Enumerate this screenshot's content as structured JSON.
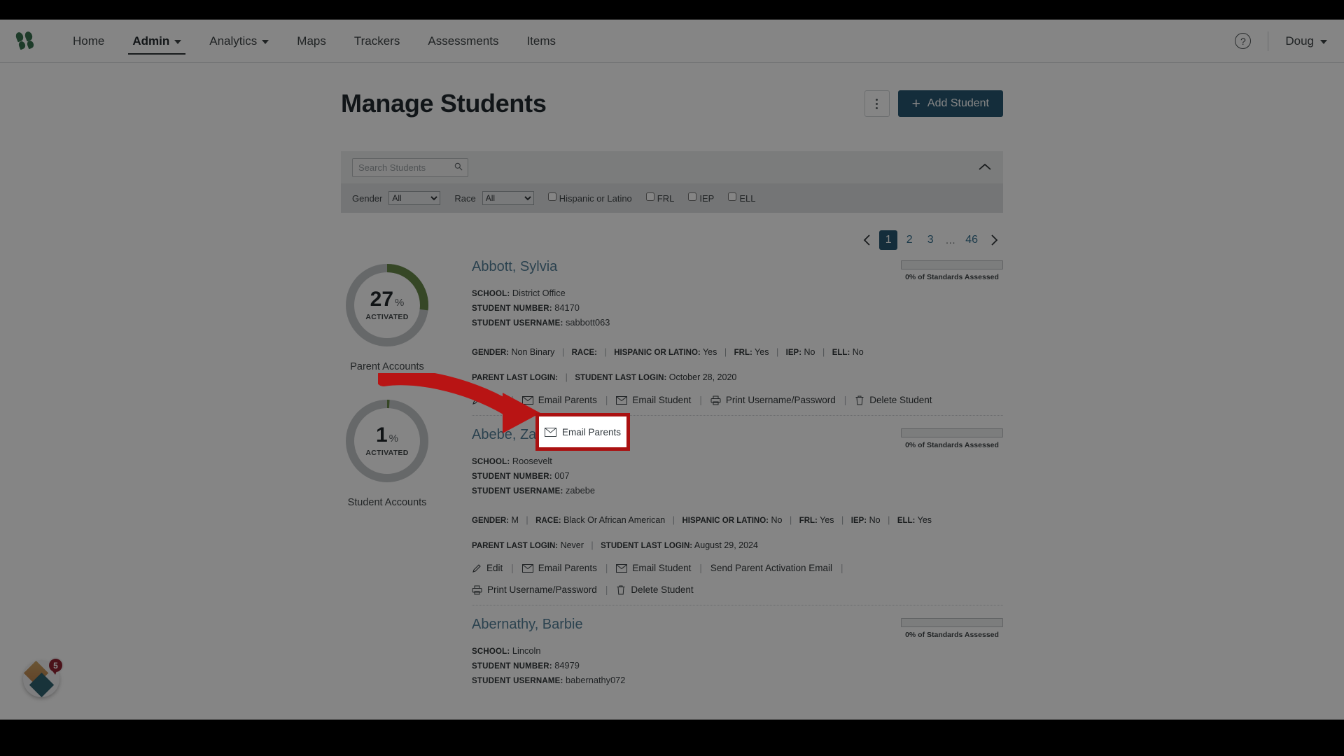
{
  "nav": {
    "logo_name": "logo-icon",
    "items": [
      {
        "label": "Home",
        "has_caret": false,
        "active": false
      },
      {
        "label": "Admin",
        "has_caret": true,
        "active": true
      },
      {
        "label": "Analytics",
        "has_caret": true,
        "active": false
      },
      {
        "label": "Maps",
        "has_caret": false,
        "active": false
      },
      {
        "label": "Trackers",
        "has_caret": false,
        "active": false
      },
      {
        "label": "Assessments",
        "has_caret": false,
        "active": false
      },
      {
        "label": "Items",
        "has_caret": false,
        "active": false
      }
    ],
    "help_glyph": "?",
    "user": "Doug"
  },
  "header": {
    "title": "Manage Students",
    "kebab_name": "more-options",
    "add_student_label": "Add Student",
    "add_student_plus": "+",
    "accent_color": "#0f5c87"
  },
  "filters": {
    "search_placeholder": "Search Students",
    "search_value": "",
    "collapse_name": "chevron-up-icon",
    "gender_label": "Gender",
    "gender_value": "All",
    "gender_options": [
      "All"
    ],
    "race_label": "Race",
    "race_value": "All",
    "race_options": [
      "All"
    ],
    "checkboxes": [
      {
        "label": "Hispanic or Latino",
        "checked": false
      },
      {
        "label": "FRL",
        "checked": false
      },
      {
        "label": "IEP",
        "checked": false
      },
      {
        "label": "ELL",
        "checked": false
      }
    ]
  },
  "pagination": {
    "prev_glyph": "‹",
    "next_glyph": "›",
    "pages": [
      "1",
      "2",
      "3"
    ],
    "ellipsis": "…",
    "last_page": "46",
    "current": "1"
  },
  "donuts": [
    {
      "value": "27",
      "pct_symbol": "%",
      "sub": "ACTIVATED",
      "label": "Parent Accounts",
      "percent": 27,
      "arc_color": "#5a8f2b",
      "track_color": "#c3c8cb"
    },
    {
      "value": "1",
      "pct_symbol": "%",
      "sub": "ACTIVATED",
      "label": "Student Accounts",
      "percent": 1,
      "arc_color": "#5a8f2b",
      "track_color": "#c3c8cb"
    }
  ],
  "field_labels": {
    "school": "SCHOOL:",
    "student_number": "STUDENT NUMBER:",
    "student_username": "STUDENT USERNAME:",
    "gender": "GENDER:",
    "race": "RACE:",
    "hispanic": "HISPANIC OR LATINO:",
    "frl": "FRL:",
    "iep": "IEP:",
    "ell": "ELL:",
    "parent_last_login": "PARENT LAST LOGIN:",
    "student_last_login": "STUDENT LAST LOGIN:"
  },
  "students": [
    {
      "name": "Abbott, Sylvia",
      "school": "District Office",
      "student_number": "84170",
      "student_username": "sabbott063",
      "gender": "Non Binary",
      "race": "",
      "hispanic": "Yes",
      "frl": "Yes",
      "iep": "No",
      "ell": "No",
      "parent_last_login": "",
      "student_last_login": "October 28, 2020",
      "standards_label": "0% of Standards Assessed",
      "standards_percent": 0,
      "actions": [
        "Edit",
        "Email Parents",
        "Email Student",
        "Print Username/Password",
        "Delete Student"
      ]
    },
    {
      "name": "Abebe, Zane",
      "school": "Roosevelt",
      "student_number": "007",
      "student_username": "zabebe",
      "gender": "M",
      "race": "Black Or African American",
      "hispanic": "No",
      "frl": "Yes",
      "iep": "No",
      "ell": "Yes",
      "parent_last_login": "Never",
      "student_last_login": "August 29, 2024",
      "standards_label": "0% of Standards Assessed",
      "standards_percent": 0,
      "actions": [
        "Edit",
        "Email Parents",
        "Email Student",
        "Send Parent Activation Email",
        "Print Username/Password",
        "Delete Student"
      ]
    },
    {
      "name": "Abernathy, Barbie",
      "school": "Lincoln",
      "student_number": "84979",
      "student_username": "babernathy072",
      "standards_label": "0% of Standards Assessed",
      "standards_percent": 0
    }
  ],
  "annotation": {
    "callout_label": "Email Parents",
    "callout_icon": "envelope-icon",
    "box_color": "#aa1111",
    "arrow_color": "#b81414"
  },
  "widget": {
    "badge_count": "5",
    "name": "help-beacon"
  }
}
